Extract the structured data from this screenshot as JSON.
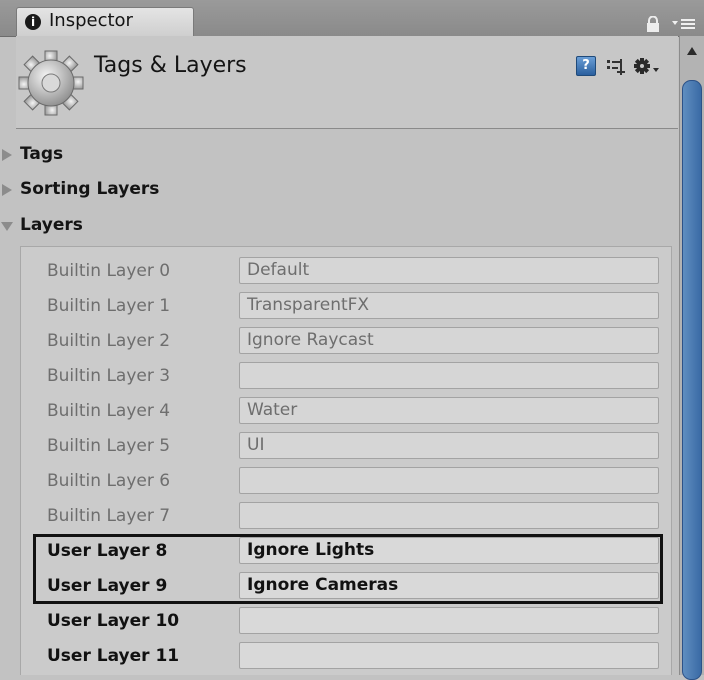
{
  "window": {
    "tab_label": "Inspector",
    "tab_icon_glyph": "i"
  },
  "header": {
    "title": "Tags & Layers",
    "help_glyph": "?"
  },
  "foldouts": [
    {
      "label": "Tags",
      "expanded": false
    },
    {
      "label": "Sorting Layers",
      "expanded": false
    },
    {
      "label": "Layers",
      "expanded": true
    }
  ],
  "layers": [
    {
      "label": "Builtin Layer 0",
      "value": "Default",
      "kind": "builtin"
    },
    {
      "label": "Builtin Layer 1",
      "value": "TransparentFX",
      "kind": "builtin"
    },
    {
      "label": "Builtin Layer 2",
      "value": "Ignore Raycast",
      "kind": "builtin"
    },
    {
      "label": "Builtin Layer 3",
      "value": "",
      "kind": "builtin"
    },
    {
      "label": "Builtin Layer 4",
      "value": "Water",
      "kind": "builtin"
    },
    {
      "label": "Builtin Layer 5",
      "value": "UI",
      "kind": "builtin"
    },
    {
      "label": "Builtin Layer 6",
      "value": "",
      "kind": "builtin"
    },
    {
      "label": "Builtin Layer 7",
      "value": "",
      "kind": "builtin"
    },
    {
      "label": "User Layer 8",
      "value": "Ignore Lights",
      "kind": "user"
    },
    {
      "label": "User Layer 9",
      "value": "Ignore Cameras",
      "kind": "user"
    },
    {
      "label": "User Layer 10",
      "value": "",
      "kind": "user"
    },
    {
      "label": "User Layer 11",
      "value": "",
      "kind": "user"
    }
  ],
  "colors": {
    "scroll_thumb": "#4a7bb5",
    "highlight_border": "#111111"
  }
}
